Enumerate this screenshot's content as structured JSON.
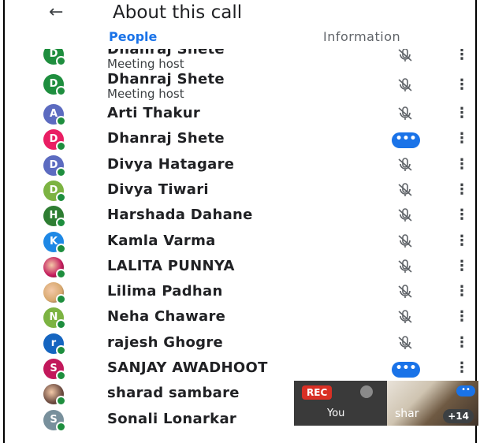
{
  "header": {
    "title": "About this call",
    "back_icon": "arrow-back-icon"
  },
  "tabs": [
    {
      "label": "People",
      "active": true
    },
    {
      "label": "Information",
      "active": false
    }
  ],
  "participants": [
    {
      "name": "Dhanraj Shete",
      "role": "Meeting host",
      "initial": "D",
      "color": "#1e8e3e",
      "status": "muted",
      "partial": true
    },
    {
      "name": "Dhanraj Shete",
      "role": "Meeting host",
      "initial": "D",
      "color": "#1e8e3e",
      "status": "muted"
    },
    {
      "name": "Arti Thakur",
      "initial": "A",
      "color": "#5c6bc0",
      "status": "muted"
    },
    {
      "name": "Dhanraj Shete",
      "initial": "D",
      "color": "#e91e63",
      "status": "speaking"
    },
    {
      "name": "Divya Hatagare",
      "initial": "D",
      "color": "#5c6bc0",
      "status": "muted"
    },
    {
      "name": "Divya Tiwari",
      "initial": "D",
      "color": "#7cb342",
      "status": "muted"
    },
    {
      "name": "Harshada Dahane",
      "initial": "H",
      "color": "#2e7d32",
      "status": "muted"
    },
    {
      "name": "Kamla Varma",
      "initial": "K",
      "color": "#1e88e5",
      "status": "muted"
    },
    {
      "name": "LALITA PUNNYA",
      "initial": "",
      "color": "#c2185b",
      "status": "muted",
      "photo": true
    },
    {
      "name": "Lilima Padhan",
      "initial": "",
      "color": "#d7a86e",
      "status": "muted",
      "photo": true
    },
    {
      "name": "Neha Chaware",
      "initial": "N",
      "color": "#7cb342",
      "status": "muted"
    },
    {
      "name": "rajesh Ghogre",
      "initial": "r",
      "color": "#1565c0",
      "status": "muted"
    },
    {
      "name": "SANJAY AWADHOOT",
      "initial": "S",
      "color": "#c2185b",
      "status": "speaking"
    },
    {
      "name": "sharad sambare",
      "initial": "",
      "color": "#6d4c41",
      "status": "none",
      "photo": true
    },
    {
      "name": "Sonali Lonarkar",
      "initial": "S",
      "color": "#78909c",
      "status": "none"
    }
  ],
  "tiles": {
    "rec_label": "REC",
    "you_label": "You",
    "other_label": "shar",
    "more_count": "+14"
  },
  "icons": {
    "muted": "mic-off-icon",
    "speaking": "audio-level-icon",
    "more": "more-vert-icon"
  },
  "colors": {
    "accent": "#1a73e8",
    "online": "#1e8e3e",
    "rec": "#d93025"
  }
}
